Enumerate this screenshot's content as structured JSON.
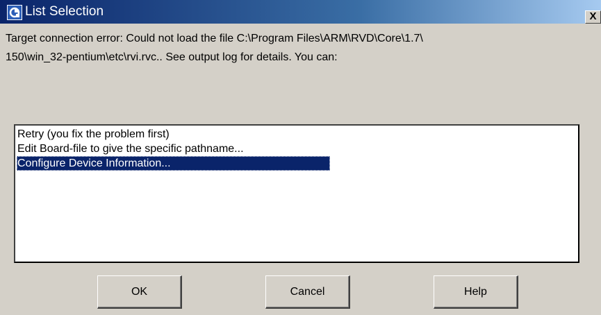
{
  "window": {
    "title": "List Selection",
    "close_glyph": "X"
  },
  "message": {
    "line1": "Target connection error: Could not load the file C:\\Program Files\\ARM\\RVD\\Core\\1.7\\",
    "line2": "150\\win_32-pentium\\etc\\rvi.rvc.. See output log for details. You can:"
  },
  "list": {
    "items": [
      {
        "label": "Retry (you fix the problem first)",
        "selected": false
      },
      {
        "label": "Edit Board-file to give the specific pathname...",
        "selected": false
      },
      {
        "label": "Configure Device Information...",
        "selected": true
      }
    ]
  },
  "buttons": {
    "ok": "OK",
    "cancel": "Cancel",
    "help": "Help"
  },
  "colors": {
    "titlebar_start": "#0a246a",
    "titlebar_end": "#a6caf0",
    "dialog_bg": "#d4d0c8",
    "selection_bg": "#0a246a"
  },
  "icons": {
    "app": "arm-debugger-icon",
    "close": "close-icon"
  }
}
